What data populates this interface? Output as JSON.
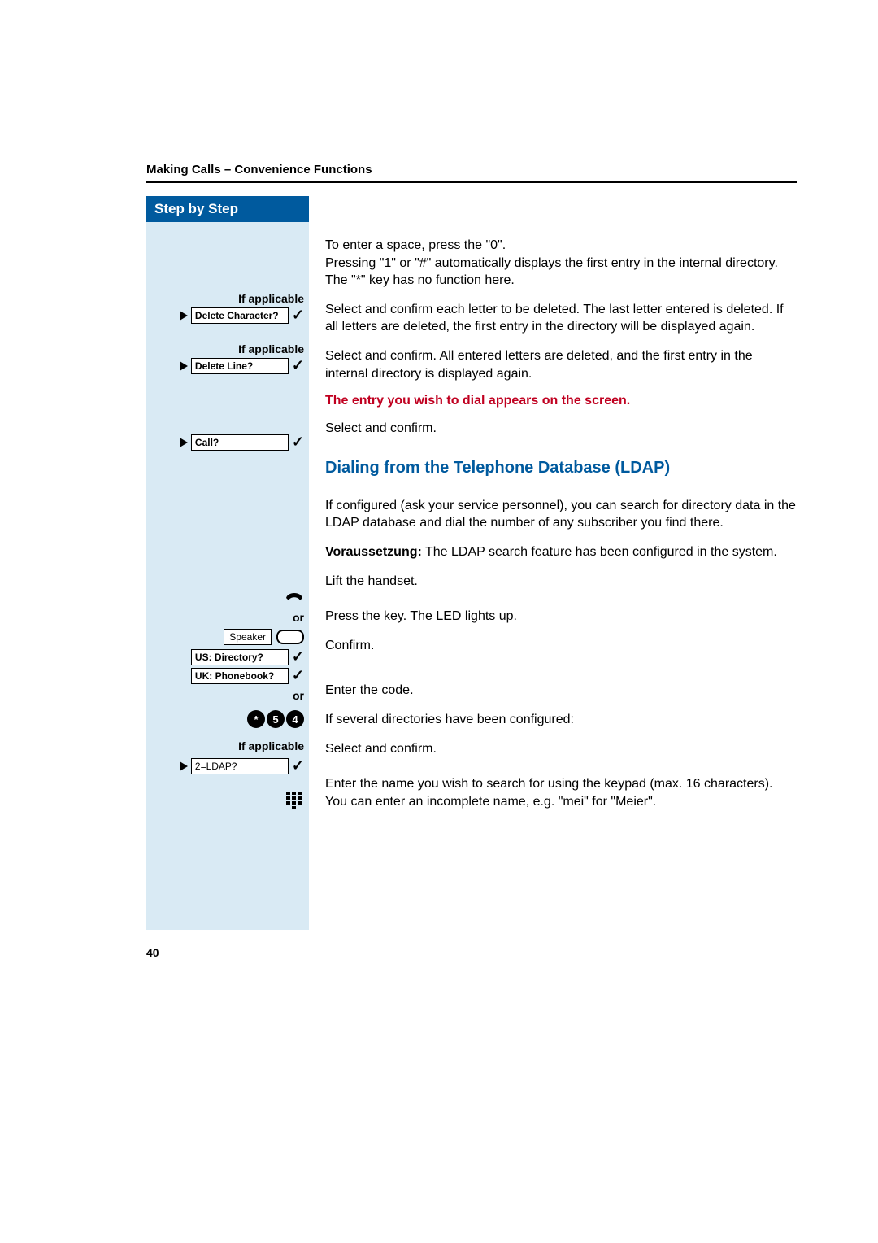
{
  "header": {
    "breadcrumb": "Making Calls – Convenience Functions"
  },
  "step_header": "Step by Step",
  "left": {
    "if_applicable": "If applicable",
    "delete_character": "Delete Character?",
    "delete_line": "Delete Line?",
    "call": "Call?",
    "or": "or",
    "speaker": "Speaker",
    "us_directory": "US: Directory?",
    "uk_phonebook": "UK: Phonebook?",
    "ldap": "2=LDAP?",
    "code_keys": [
      "*",
      "5",
      "4"
    ]
  },
  "right": {
    "p1": "To enter a space, press the \"0\".\nPressing \"1\" or \"#\" automatically displays the first entry in the internal directory.\nThe \"*\" key has no function here.",
    "p2": "Select and confirm each letter to be deleted. The last letter entered is deleted. If all letters are deleted, the first entry in the directory will be displayed again.",
    "p3": "Select and confirm. All entered letters are deleted, and the first entry in the internal directory is displayed again.",
    "red_heading": "The entry you wish to dial appears on the screen.",
    "p4": "Select and confirm.",
    "blue_heading": "Dialing from the Telephone Database (LDAP)",
    "p5": "If configured (ask your service personnel), you can search for directory data in the LDAP database and dial the number of any subscriber you find there.",
    "p6_prefix": "Voraussetzung:",
    "p6": " The LDAP search feature has been configured in the system.",
    "p7": "Lift the handset.",
    "p8": "Press the key. The LED lights up.",
    "p9": "Confirm.",
    "p10": "Enter the code.",
    "p11": "If several directories have been configured:",
    "p12": "Select and confirm.",
    "p13": "Enter the name you wish to search for using the keypad (max. 16 characters).\nYou can enter an incomplete name, e.g. \"mei\" for \"Meier\"."
  },
  "page_number": "40"
}
